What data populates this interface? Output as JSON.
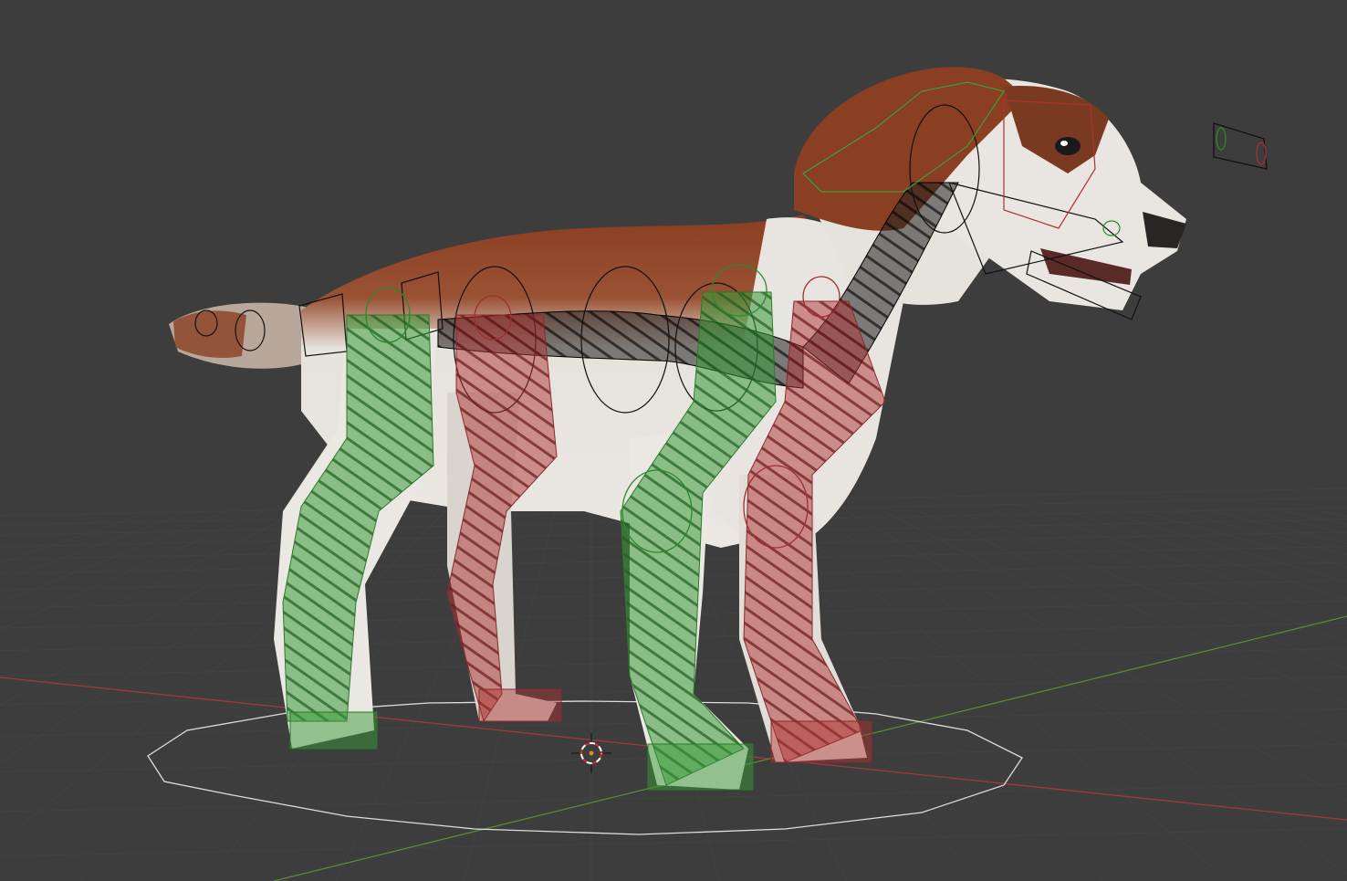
{
  "viewport": {
    "mode": "3d-viewport",
    "shading": "material-preview",
    "background_color": "#3d3d3d",
    "grid_color": "#4a4a4a",
    "x_axis_color": "#a0383e",
    "y_axis_color": "#5a8a2e"
  },
  "scene": {
    "subject": "dog-model",
    "fur_colors": {
      "brown": "#8a3e22",
      "white": "#e6e2dc"
    },
    "armature": {
      "left_side_color": "#3a9a3a",
      "right_side_color": "#b03434",
      "center_color": "#111111"
    },
    "root_control_color": "#dddddd"
  },
  "cursor": {
    "name": "3d-cursor",
    "colors": {
      "ring_a": "#d02a2a",
      "ring_b": "#ffffff",
      "center": "#e08a1c"
    }
  }
}
